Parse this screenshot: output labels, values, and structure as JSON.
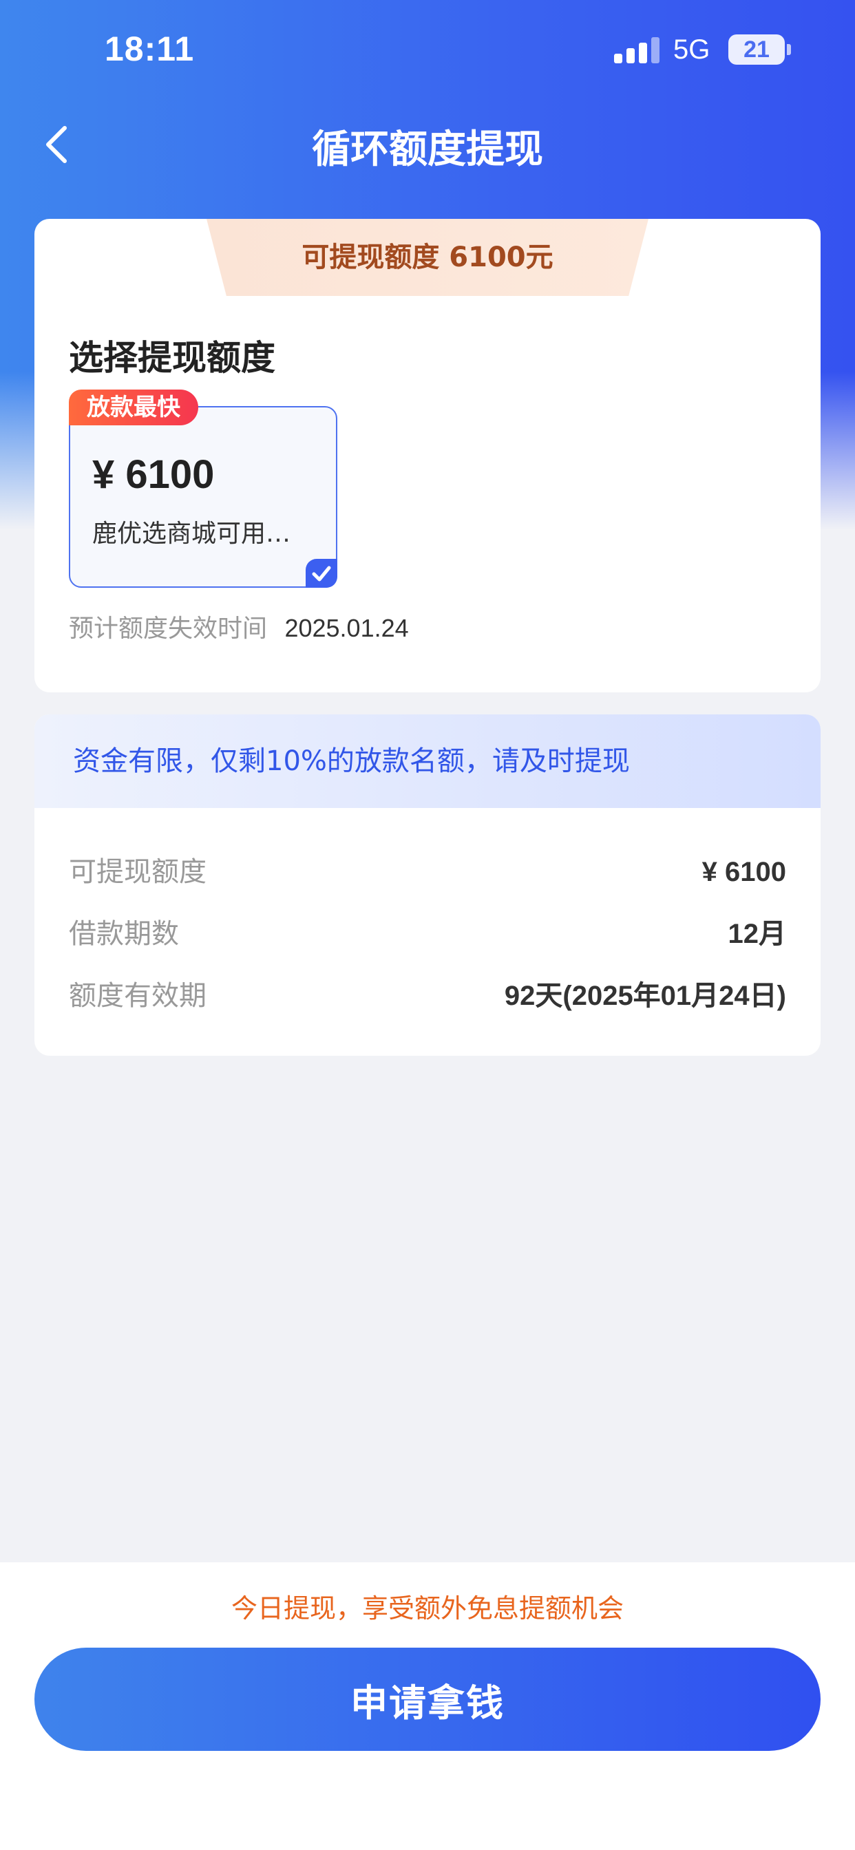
{
  "status_bar": {
    "time": "18:11",
    "network": "5G",
    "battery": "21"
  },
  "nav": {
    "title": "循环额度提现"
  },
  "withdraw_card": {
    "banner": "可提现额度 6100元",
    "section_title": "选择提现额度",
    "option": {
      "badge": "放款最快",
      "amount": "¥ 6100",
      "description": "鹿优选商城可用…"
    },
    "expire_label": "预计额度失效时间",
    "expire_value": "2025.01.24"
  },
  "detail_card": {
    "notice": "资金有限，仅剩10%的放款名额，请及时提现",
    "rows": [
      {
        "label": "可提现额度",
        "value": "¥ 6100"
      },
      {
        "label": "借款期数",
        "value": "12月"
      },
      {
        "label": "额度有效期",
        "value": "92天(2025年01月24日)"
      }
    ]
  },
  "bottom": {
    "promo": "今日提现，享受额外免息提额机会",
    "button_label": "申请拿钱"
  },
  "colors": {
    "primary": "#3a63f0",
    "accent_orange": "#e8651e",
    "badge_red": "#f5364f"
  }
}
